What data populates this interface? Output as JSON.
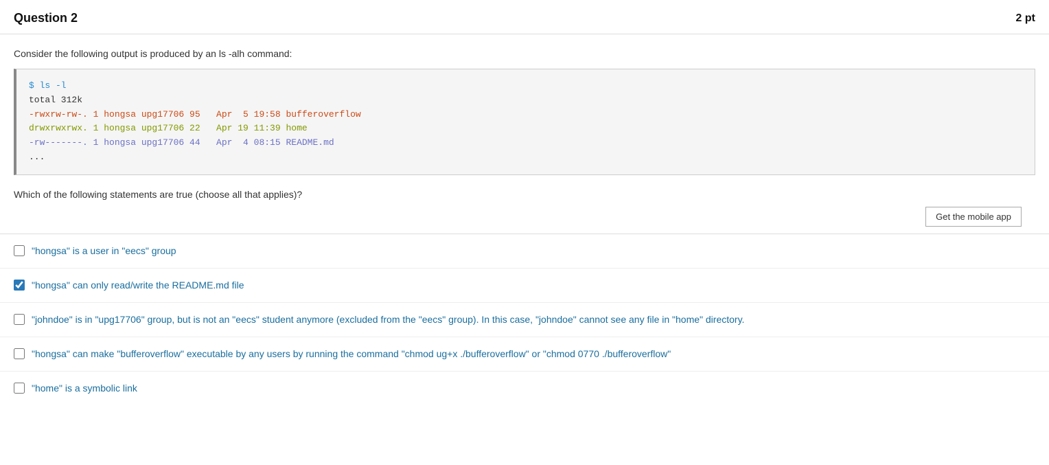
{
  "header": {
    "title": "Question 2",
    "points": "2 pt"
  },
  "question": {
    "intro_text": "Consider the following output is produced by an ls -alh command:",
    "code_lines": [
      "$ ls -l",
      "total 312k",
      "-rwxrw-rw-. 1 hongsa upg17706 95   Apr  5 19:58 bufferoverflow",
      "drwxrwxrwx. 1 hongsa upg17706 22   Apr 19 11:39 home",
      "-rw-------. 1 hongsa upg17706 44   Apr  4 08:15 README.md",
      "..."
    ],
    "instruction": "Which of the following statements are true (choose all that applies)?",
    "mobile_app_button": "Get the mobile app",
    "options": [
      {
        "id": "opt1",
        "text": "\"hongsa\" is a user in \"eecs\" group",
        "checked": false
      },
      {
        "id": "opt2",
        "text": "\"hongsa\" can only read/write the README.md file",
        "checked": true
      },
      {
        "id": "opt3",
        "text": "\"johndoe\" is in \"upg17706\" group, but is not an \"eecs\" student anymore (excluded from the \"eecs\" group). In this case, \"johndoe\" cannot see any file in \"home\" directory.",
        "checked": false
      },
      {
        "id": "opt4",
        "text": "\"hongsa\" can make \"bufferoverflow\" executable by any users by running the command \"chmod ug+x ./bufferoverflow\" or \"chmod 0770 ./bufferoverflow\"",
        "checked": false
      },
      {
        "id": "opt5",
        "text": "\"home\" is a symbolic link",
        "checked": false
      }
    ]
  }
}
